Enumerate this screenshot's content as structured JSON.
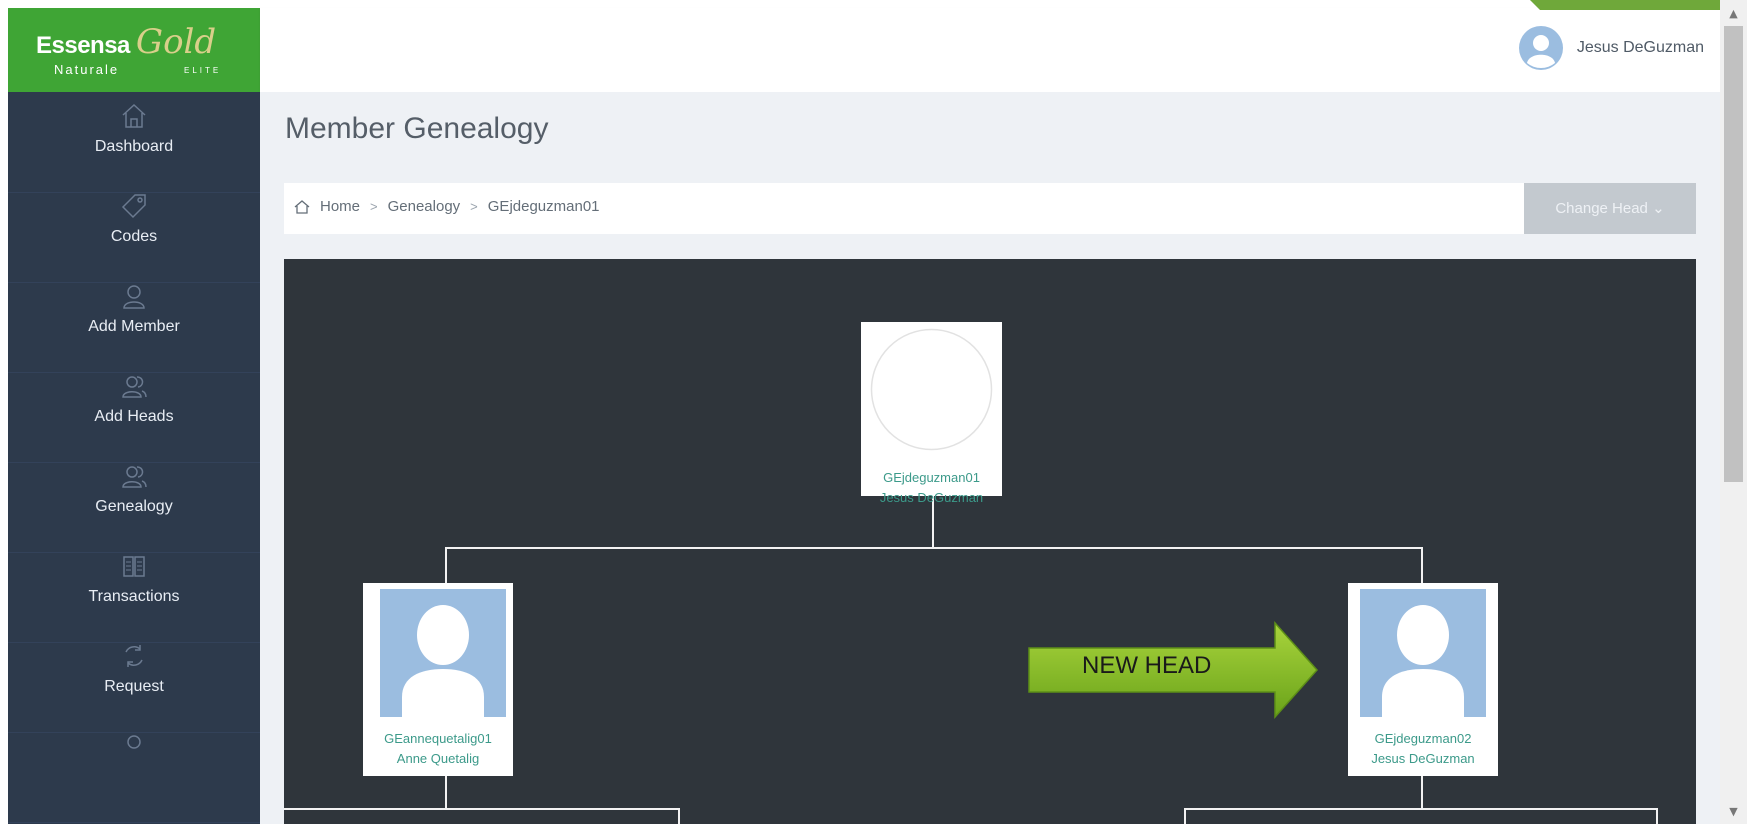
{
  "brand": {
    "name_main": "Essensa",
    "name_script": "Gold",
    "name_sub": "Naturale",
    "name_tag": "ELITE"
  },
  "sidebar": {
    "items": [
      {
        "label": "Dashboard",
        "icon": "home-icon"
      },
      {
        "label": "Codes",
        "icon": "tag-icon"
      },
      {
        "label": "Add Member",
        "icon": "user-icon"
      },
      {
        "label": "Add Heads",
        "icon": "users-icon"
      },
      {
        "label": "Genealogy",
        "icon": "users-icon"
      },
      {
        "label": "Transactions",
        "icon": "book-icon"
      },
      {
        "label": "Request",
        "icon": "refresh-icon"
      }
    ]
  },
  "header": {
    "user_name": "Jesus DeGuzman"
  },
  "page": {
    "title": "Member Genealogy"
  },
  "breadcrumb": {
    "items": [
      "Home",
      "Genealogy",
      "GEjdeguzman01"
    ],
    "separator": ">"
  },
  "change_head": {
    "label": "Change Head",
    "caret": "⌄"
  },
  "tree": {
    "root": {
      "username": "GEjdeguzman01",
      "name": "Jesus DeGuzman"
    },
    "left": {
      "username": "GEannequetalig01",
      "name": "Anne Quetalig"
    },
    "right": {
      "username": "GEjdeguzman02",
      "name": "Jesus DeGuzman"
    }
  },
  "annotation": {
    "text": "NEW HEAD",
    "color": "#7ab51d"
  },
  "colors": {
    "brand_green": "#3fa535",
    "sidebar_bg": "#2d3a4c",
    "tree_bg": "#2f353b",
    "link_teal": "#3c9a8a"
  }
}
